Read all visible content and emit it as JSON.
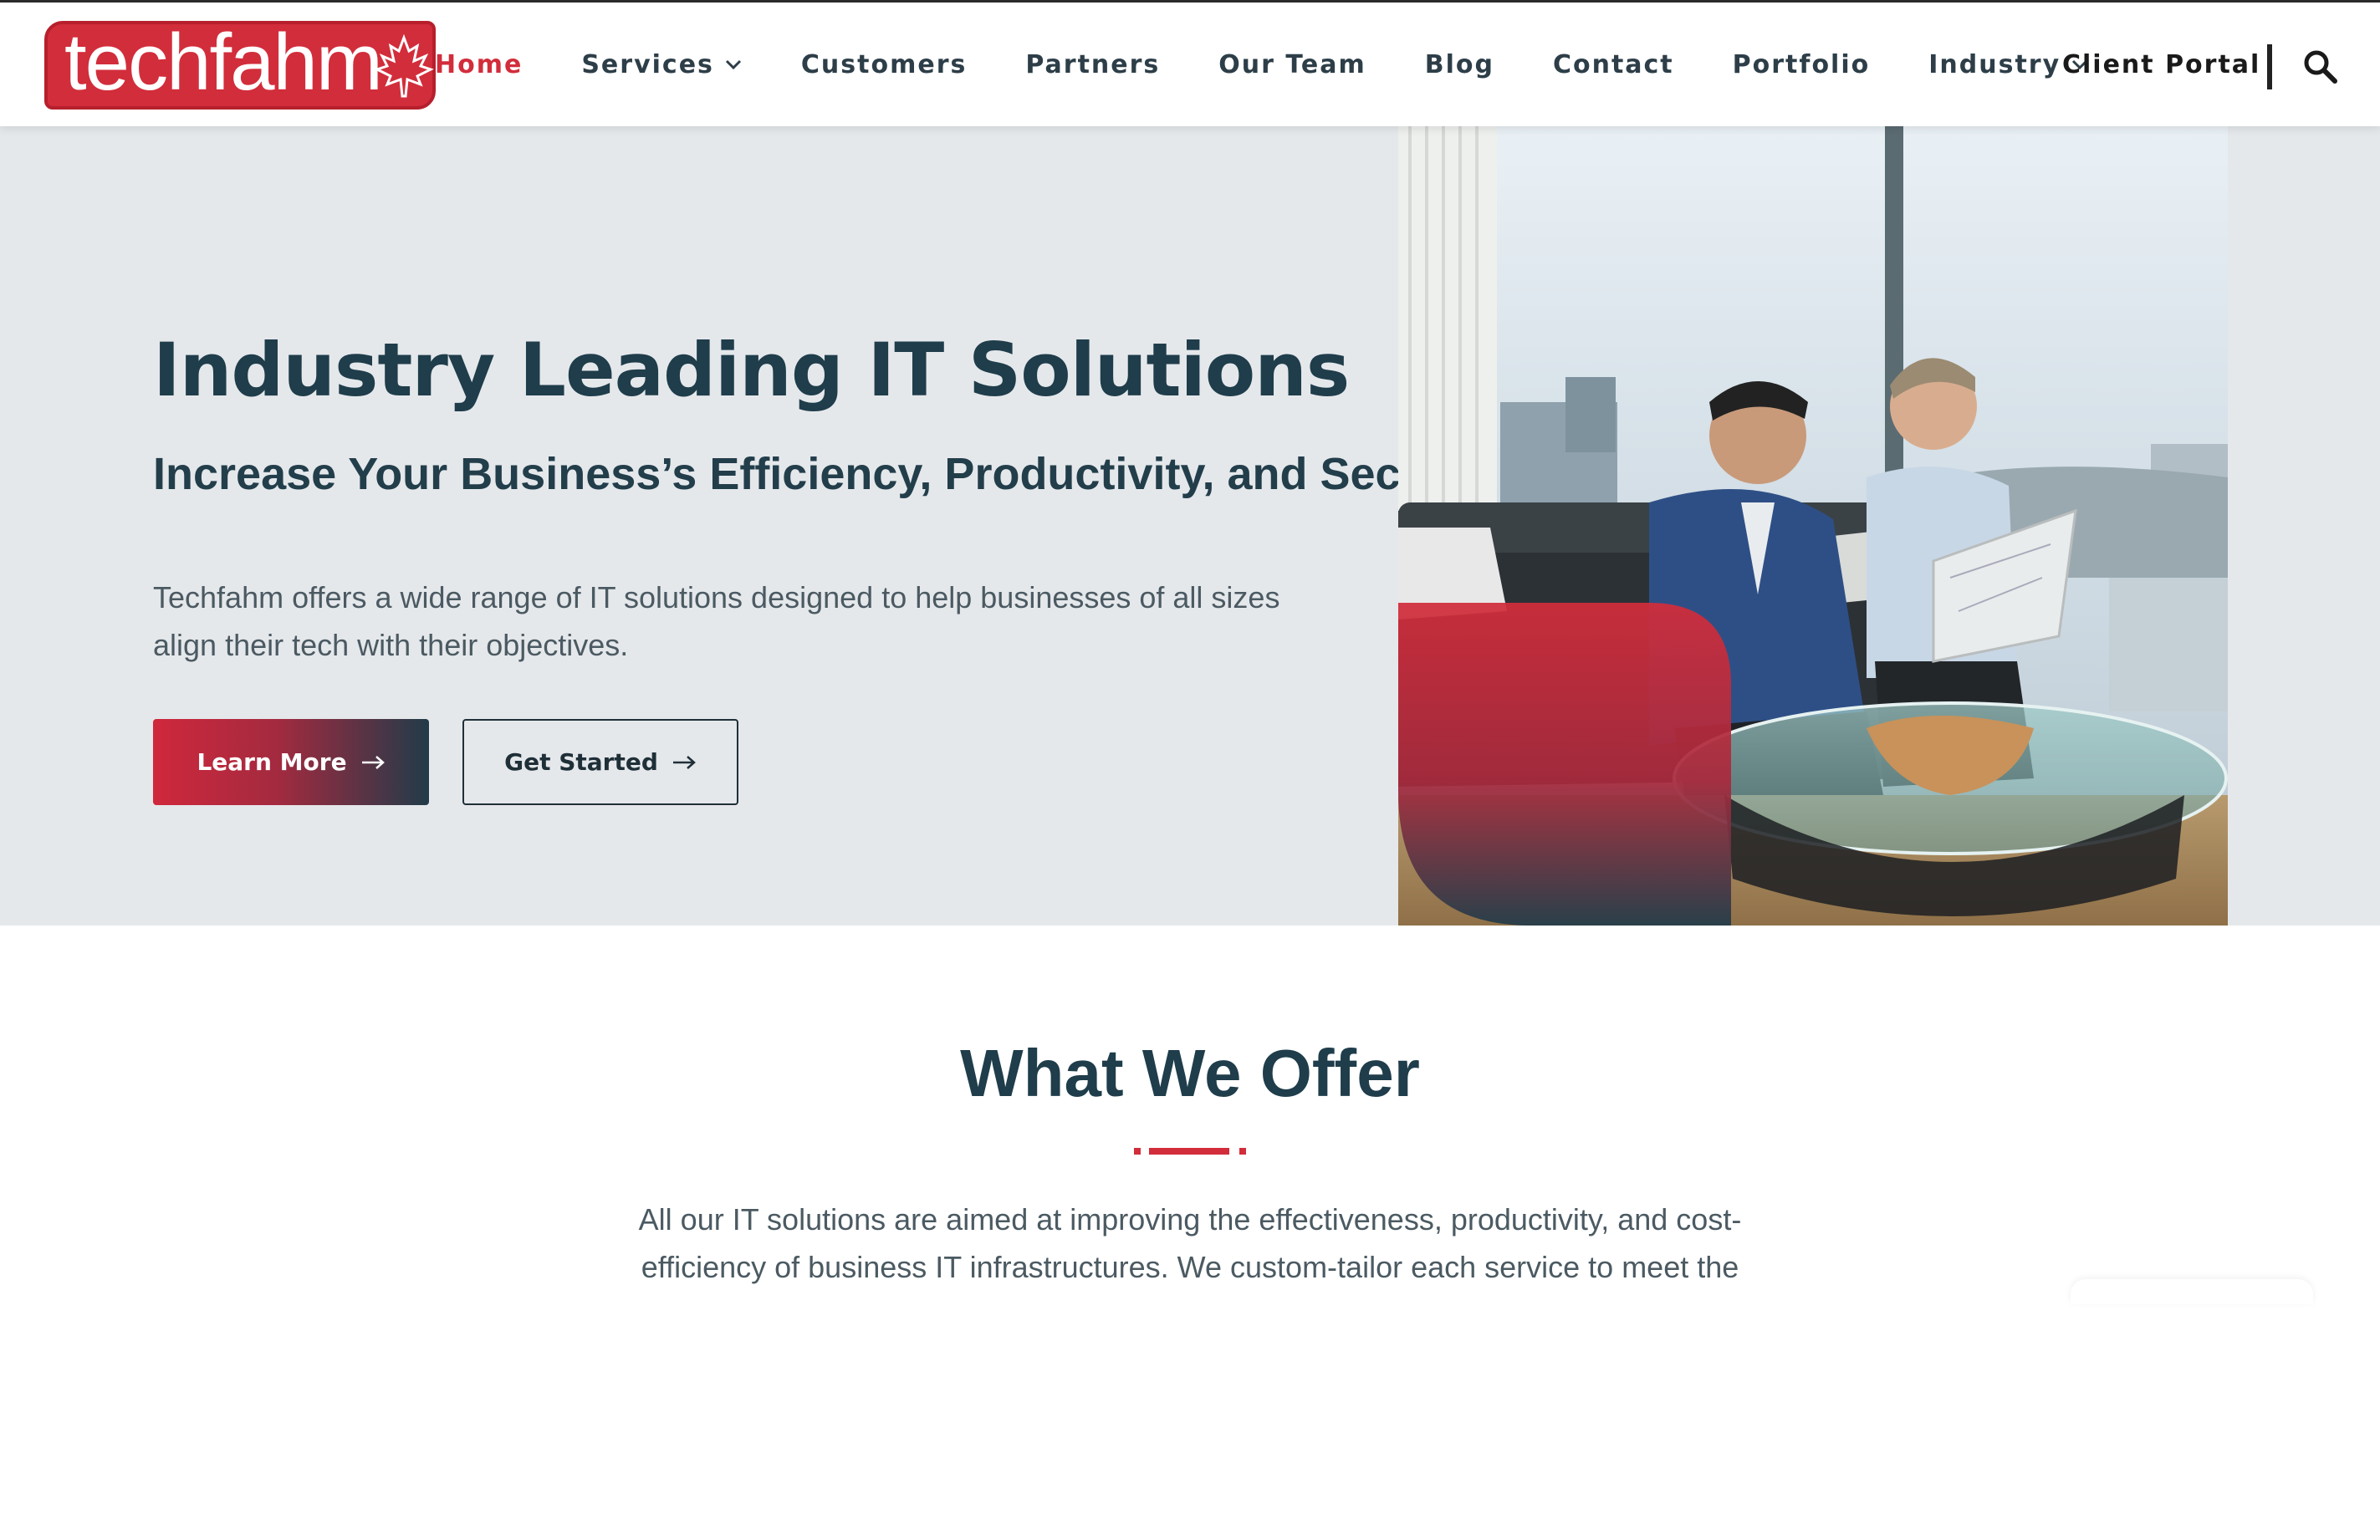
{
  "brand": {
    "logo_text": "techfahm",
    "colors": {
      "accent": "#d22d3b",
      "navy": "#1f3d4b",
      "hero_bg": "#e5e8eb"
    }
  },
  "nav": {
    "items": [
      {
        "label": "Home",
        "active": true,
        "dropdown": false
      },
      {
        "label": "Services",
        "active": false,
        "dropdown": true
      },
      {
        "label": "Customers",
        "active": false,
        "dropdown": false
      },
      {
        "label": "Partners",
        "active": false,
        "dropdown": false
      },
      {
        "label": "Our Team",
        "active": false,
        "dropdown": false
      },
      {
        "label": "Blog",
        "active": false,
        "dropdown": false
      },
      {
        "label": "Contact",
        "active": false,
        "dropdown": false
      },
      {
        "label": "Portfolio",
        "active": false,
        "dropdown": false
      },
      {
        "label": "Industry",
        "active": false,
        "dropdown": true
      }
    ],
    "client_portal": "Client Portal",
    "search_icon": "search-icon"
  },
  "hero": {
    "title": "Industry Leading IT Solutions",
    "subtitle": "Increase Your Business’s Efficiency, Productivity, and Security",
    "description": "Techfahm offers a wide range of IT solutions designed to help businesses of all sizes align their tech with their objectives.",
    "primary_button": "Learn More",
    "secondary_button": "Get Started"
  },
  "offer": {
    "title": "What We Offer",
    "text": "All our IT solutions are aimed at improving the effectiveness, productivity, and cost-efficiency of business IT infrastructures. We custom-tailor each service to meet the"
  }
}
